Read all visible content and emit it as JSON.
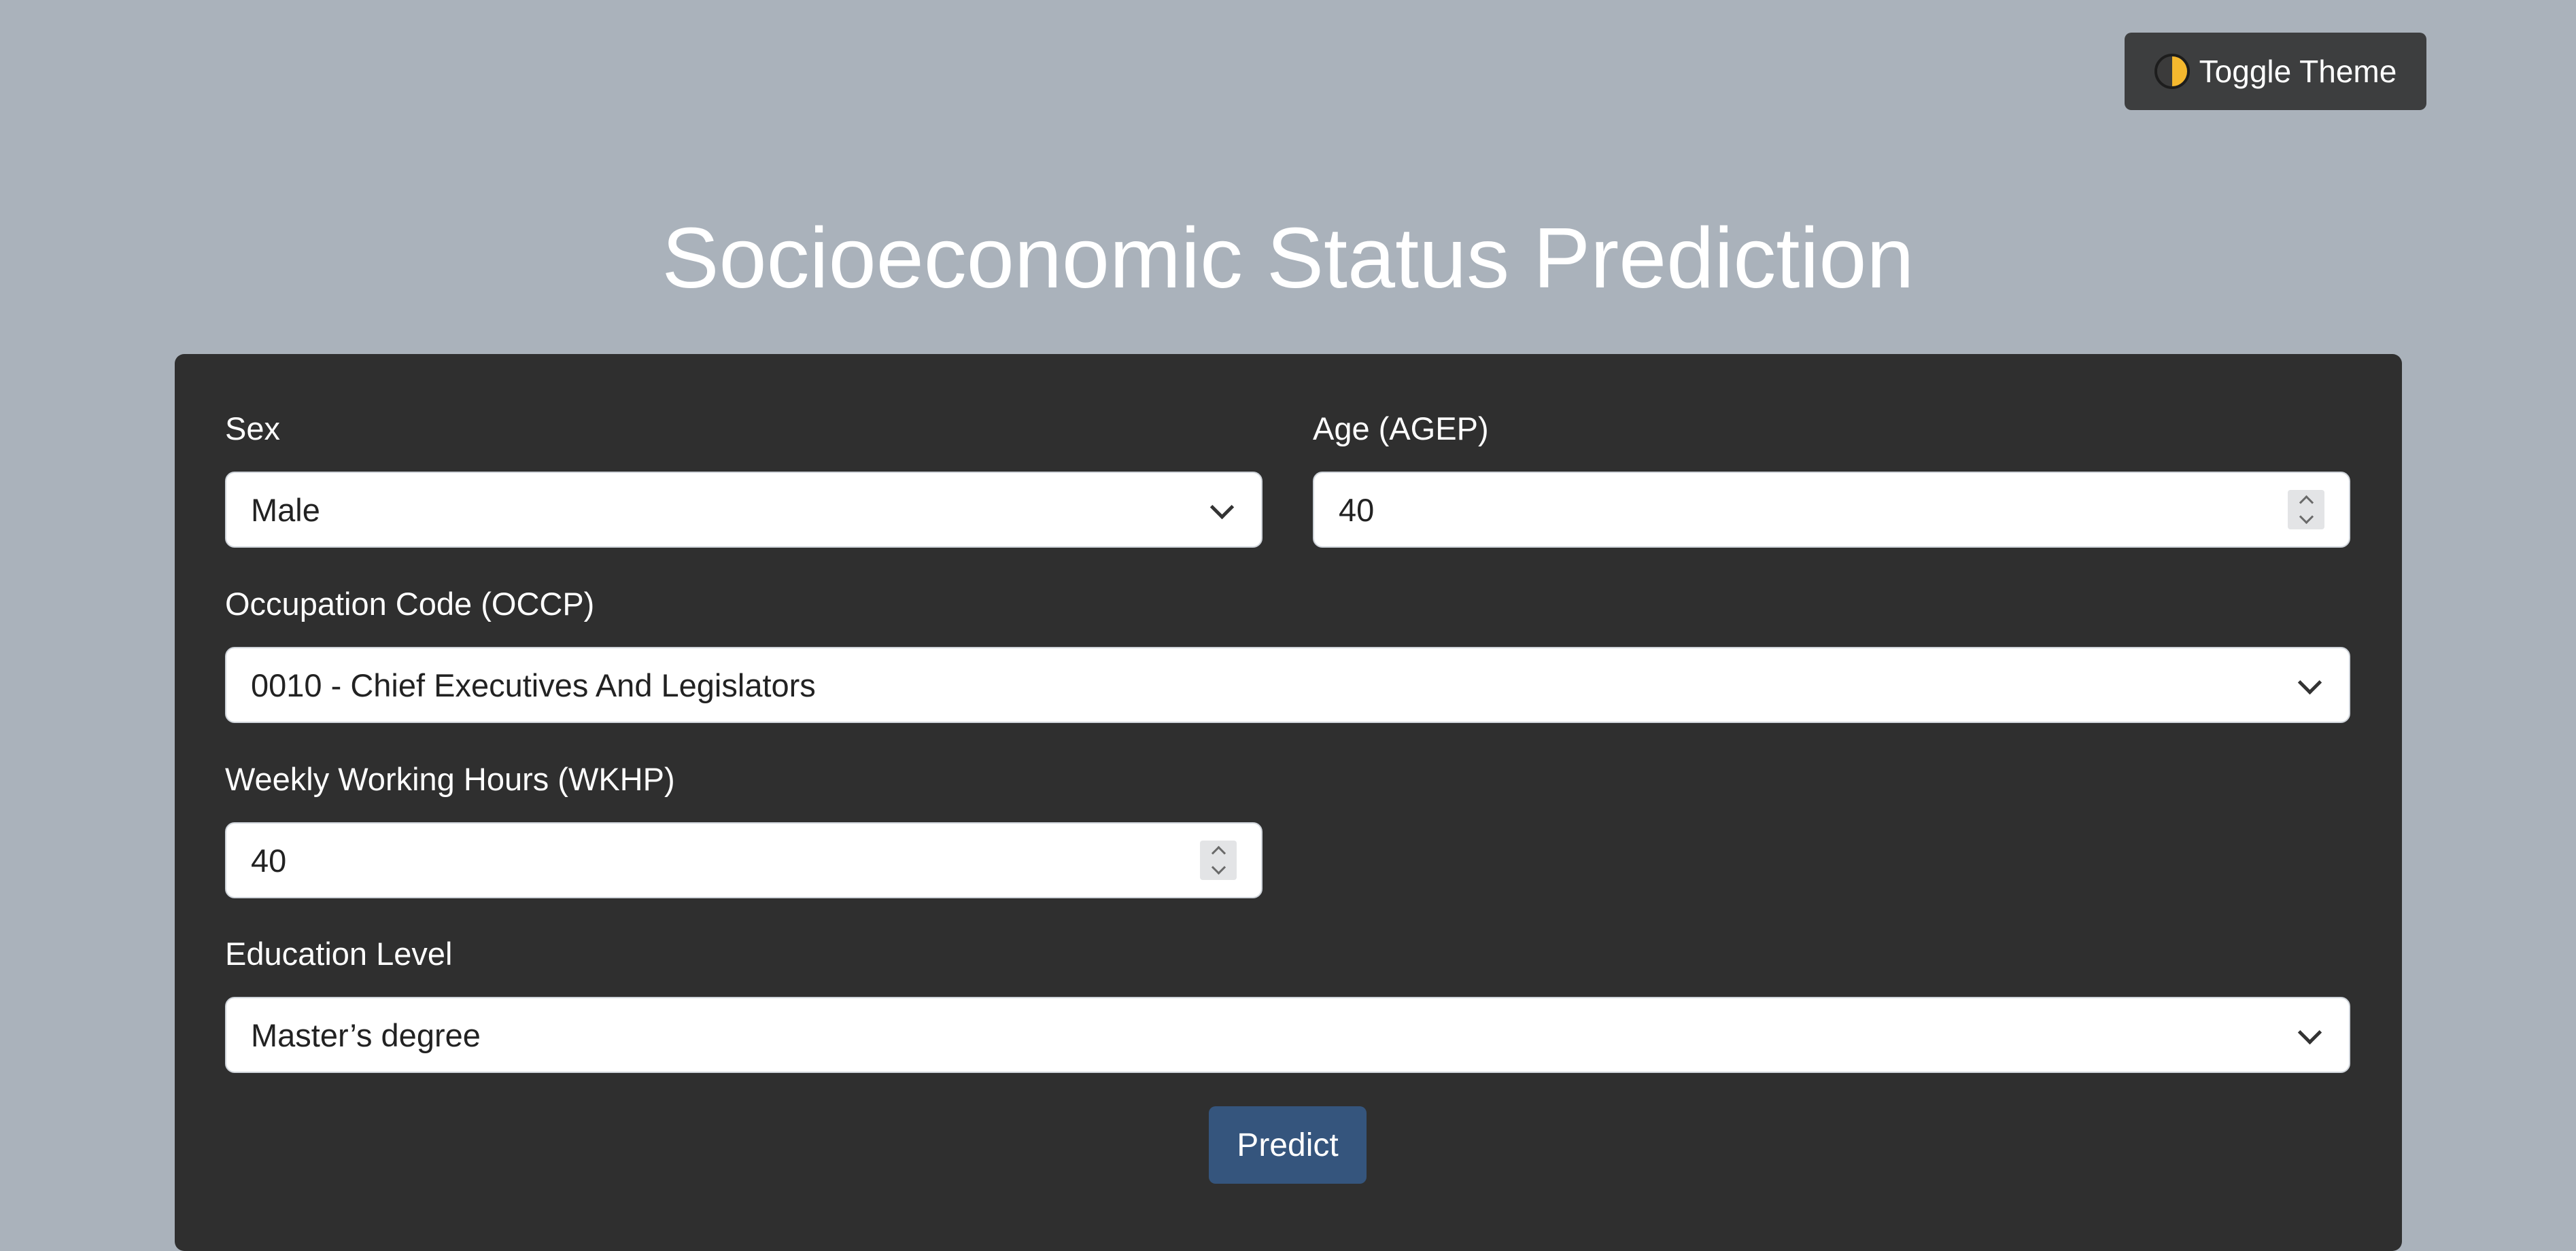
{
  "header": {
    "toggle_theme_label": "Toggle Theme",
    "toggle_theme_icon": "half-moon-theme-icon"
  },
  "page": {
    "title": "Socioeconomic Status Prediction"
  },
  "form": {
    "sex": {
      "label": "Sex",
      "value": "Male"
    },
    "age": {
      "label": "Age (AGEP)",
      "value": "40"
    },
    "occupation": {
      "label": "Occupation Code (OCCP)",
      "value": "0010 - Chief Executives And Legislators"
    },
    "hours": {
      "label": "Weekly Working Hours (WKHP)",
      "value": "40"
    },
    "education": {
      "label": "Education Level",
      "value": "Master’s degree"
    },
    "predict_label": "Predict"
  },
  "colors": {
    "background": "#aab2bb",
    "card": "#2f2f2f",
    "toggle_button": "#3d3e3f",
    "predict_button": "#35557d"
  }
}
